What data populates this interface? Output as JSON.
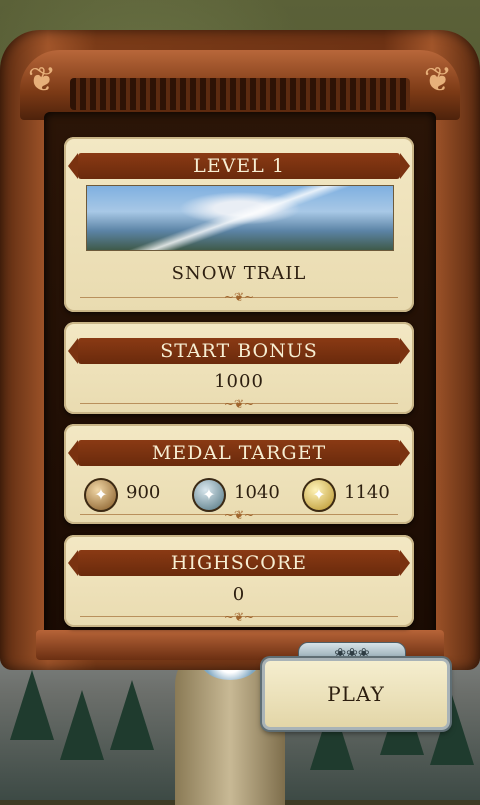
{
  "level_panel": {
    "banner": "LEVEL 1",
    "level_name": "SNOW TRAIL"
  },
  "start_bonus_panel": {
    "banner": "START BONUS",
    "value": "1000"
  },
  "medal_panel": {
    "banner": "MEDAL TARGET",
    "medals": [
      {
        "type": "bronze",
        "value": "900"
      },
      {
        "type": "silver",
        "value": "1040"
      },
      {
        "type": "gold",
        "value": "1140"
      }
    ]
  },
  "highscore_panel": {
    "banner": "HIGHSCORE",
    "value": "0"
  },
  "play_button": {
    "label": "PLAY"
  },
  "colors": {
    "banner": "#7a3210",
    "parchment": "#efe3bc",
    "frame_wood": "#8a4420"
  }
}
